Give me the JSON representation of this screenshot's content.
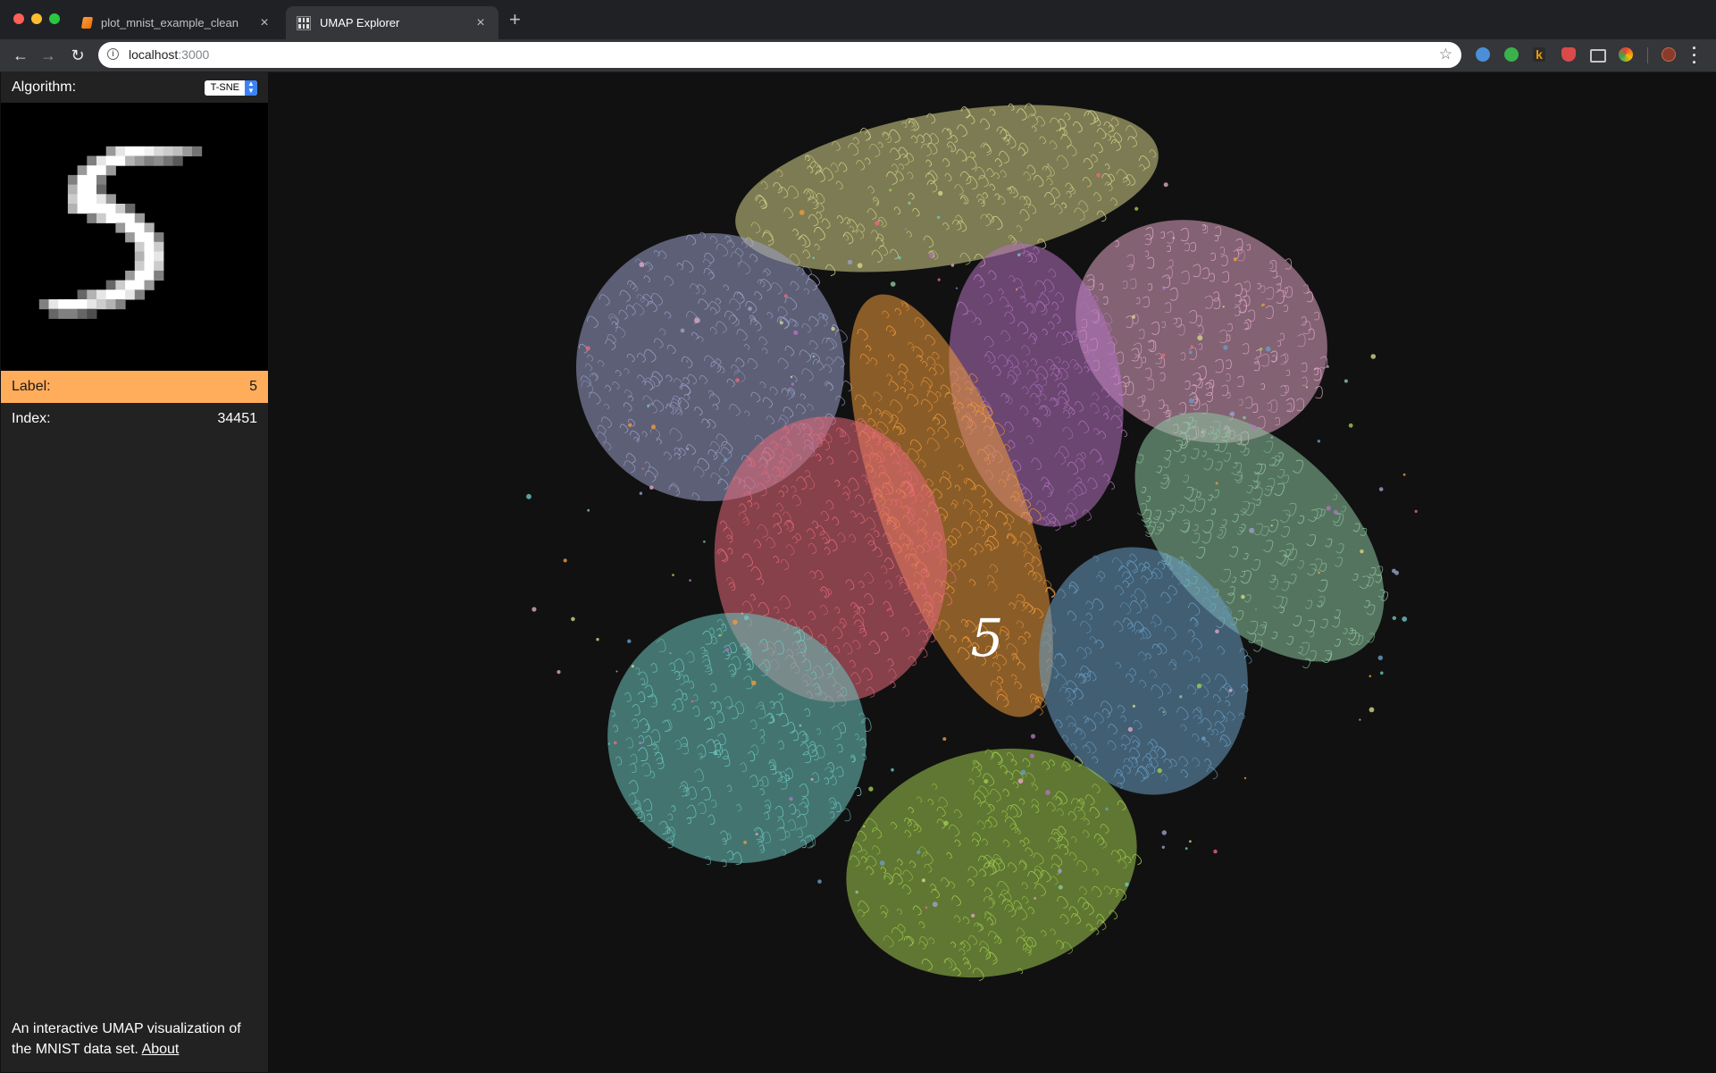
{
  "browser": {
    "tabs": [
      {
        "title": "plot_mnist_example_clean",
        "icon": "notebook-icon",
        "active": false
      },
      {
        "title": "UMAP Explorer",
        "icon": "grid-favicon-icon",
        "active": true
      }
    ],
    "url_host": "localhost",
    "url_port": ":3000",
    "close_glyph": "×",
    "new_tab_glyph": "+"
  },
  "sidebar": {
    "algorithm_label": "Algorithm:",
    "algorithm_value": "T-SNE",
    "label_key": "Label:",
    "label_value": "5",
    "index_key": "Index:",
    "index_value": "34451",
    "about_text": "An interactive UMAP visualization of the MNIST data set.",
    "about_link": "About"
  },
  "scatter": {
    "hover_label": "5",
    "cluster_colors": {
      "0": "#e8697a",
      "1": "#d6d48a",
      "2": "#9aa0c8",
      "3": "#ef9b3c",
      "4": "#8ec6a0",
      "5": "#b472c0",
      "6": "#6ec6c0",
      "7": "#a0cc4e",
      "8": "#e0a6c4",
      "9": "#6a9ec4"
    },
    "highlight_color": "#ffad5b"
  }
}
